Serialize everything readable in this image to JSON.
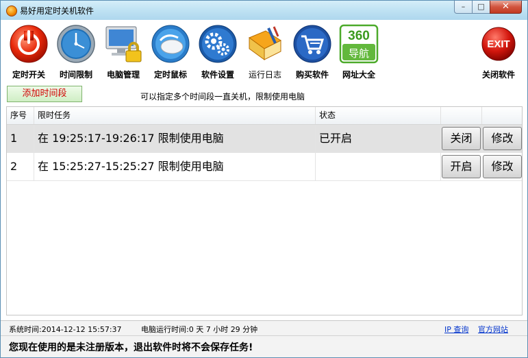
{
  "window": {
    "title": "易好用定时关机软件",
    "min_glyph": "–",
    "max_glyph": "□",
    "close_glyph": "✕"
  },
  "toolbar": {
    "items": [
      {
        "label": "定时开关",
        "icon": "power-icon"
      },
      {
        "label": "时间限制",
        "icon": "clock-icon"
      },
      {
        "label": "电脑管理",
        "icon": "monitor-lock-icon"
      },
      {
        "label": "定时鼠标",
        "icon": "mouse-icon"
      },
      {
        "label": "软件设置",
        "icon": "gears-icon"
      },
      {
        "label": "运行日志",
        "icon": "log-book-icon"
      },
      {
        "label": "购买软件",
        "icon": "cart-icon"
      },
      {
        "label": "网址大全",
        "icon": "nav-360-icon",
        "badge_top": "360",
        "badge_bottom": "导航"
      },
      {
        "label": "关闭软件",
        "icon": "exit-icon",
        "badge": "EXIT"
      }
    ]
  },
  "subbar": {
    "add_label": "添加时间段",
    "hint": "可以指定多个时间段一直关机，限制使用电脑"
  },
  "table": {
    "headers": [
      "序号",
      "限时任务",
      "状态"
    ],
    "rows": [
      {
        "index": "1",
        "task": "在 19:25:17-19:26:17 限制使用电脑",
        "status": "已开启",
        "toggle_label": "关闭",
        "edit_label": "修改"
      },
      {
        "index": "2",
        "task": "在 15:25:27-15:25:27 限制使用电脑",
        "status": "",
        "toggle_label": "开启",
        "edit_label": "修改"
      }
    ]
  },
  "status": {
    "system_time": "系统时间:2014-12-12 15:57:37",
    "uptime": "电脑运行时间:0 天 7 小时 29 分钟",
    "ip_link": "IP 查询",
    "site_link": "官方网站"
  },
  "notice": "您现在使用的是未注册版本，退出软件时将不会保存任务!",
  "colors": {
    "accent_red": "#d10000",
    "link": "#0033cc",
    "selected_row": "#e2e2e2"
  }
}
